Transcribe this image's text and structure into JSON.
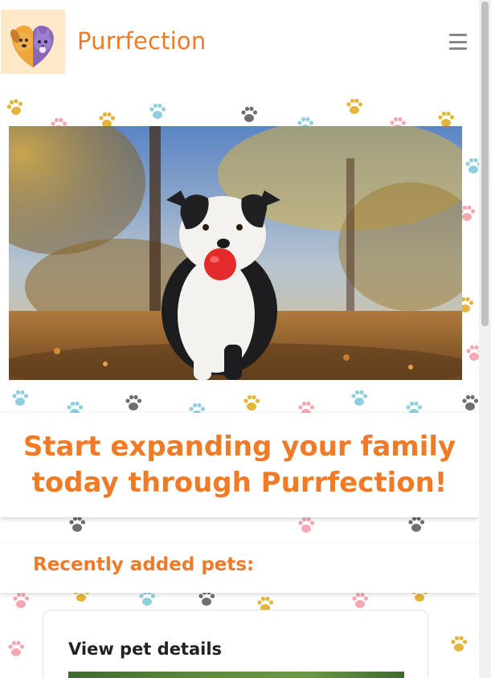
{
  "navbar": {
    "brand": "Purrfection",
    "logo_icon": "cat-and-dog-logo",
    "menu_icon": "hamburger-menu-icon"
  },
  "hero": {
    "image": "dog-with-red-ball-photo",
    "title": "Start expanding your family today through Purrfection!"
  },
  "recent": {
    "title": "Recently added pets:"
  },
  "pet_card": {
    "link_label": "View pet details",
    "image": "pet-photo"
  },
  "colors": {
    "accent": "#f07a25",
    "logo_bg": "#fde9c8",
    "paw_yellow": "#e3b53b",
    "paw_blue": "#8fd0df",
    "paw_gray": "#6f6f6f",
    "paw_pink": "#f4a8b3"
  }
}
